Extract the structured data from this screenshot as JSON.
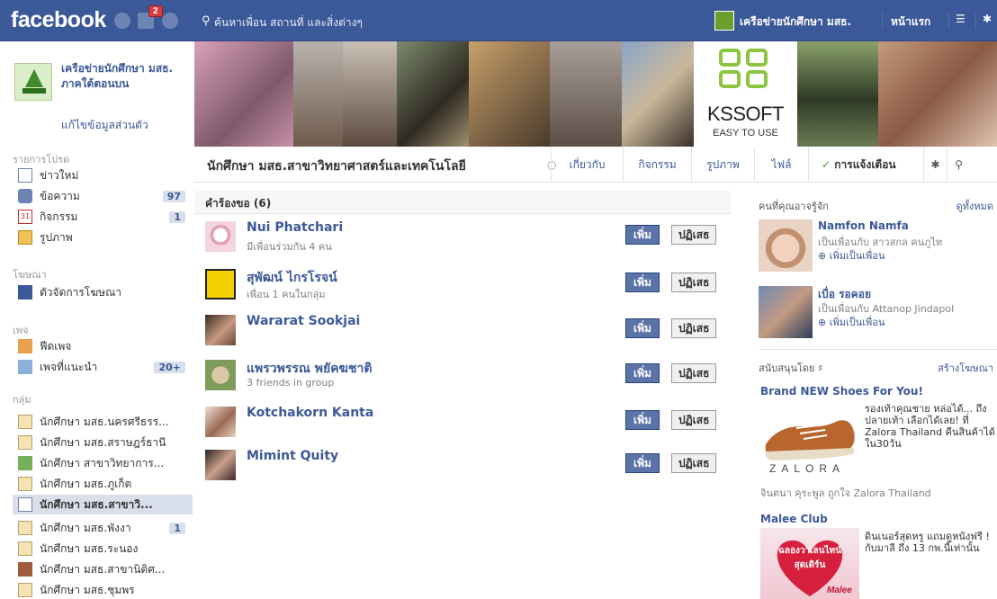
{
  "topbar": {
    "logo": "facebook",
    "notif_count": "2",
    "search_placeholder": "ค้นหาเพื่อน สถานที่ และสิ่งต่างๆ",
    "profile_name": "เครือข่ายนักศึกษา มสธ.",
    "home_label": "หน้าแรก"
  },
  "left": {
    "profile_name": "เครือข่ายนักศึกษา มสธ. ภาคใต้ตอนบน",
    "edit_profile": "แก้ไขข้อมูลส่วนตัว",
    "favorites_heading": "รายการโปรด",
    "favorites": [
      {
        "label": "ข่าวใหม่",
        "icon": "news-feed-icon",
        "count": ""
      },
      {
        "label": "ข้อความ",
        "icon": "messages-icon",
        "count": "97"
      },
      {
        "label": "กิจกรรม",
        "icon": "events-icon",
        "count": "1"
      },
      {
        "label": "รูปภาพ",
        "icon": "photos-icon",
        "count": ""
      }
    ],
    "ads_heading": "โฆษณา",
    "ads_item": "ตัวจัดการโฆษณา",
    "pages_heading": "เพจ",
    "pages": [
      {
        "label": "ฟีดเพจ",
        "count": ""
      },
      {
        "label": "เพจที่แนะนำ",
        "count": "20+"
      }
    ],
    "groups_heading": "กลุ่ม",
    "groups": [
      {
        "label": "นักศึกษา มสธ.นครศรีธรร...",
        "count": ""
      },
      {
        "label": "นักศึกษา มสธ.สราษฎร์ธานี",
        "count": ""
      },
      {
        "label": "นักศึกษา สาขาวิทยาการ...",
        "count": ""
      },
      {
        "label": "นักศึกษา มสธ.ภูเก็ต",
        "count": ""
      },
      {
        "label": "นักศึกษา มสธ.สาขาวิ...",
        "count": ""
      },
      {
        "label": "นักศึกษา มสธ.พังงา",
        "count": "1"
      },
      {
        "label": "นักศึกษา มสธ.ระนอง",
        "count": ""
      },
      {
        "label": "นักศึกษา มสธ.สาขานิติศ...",
        "count": ""
      },
      {
        "label": "นักศึกษา มสธ.ชุมพร",
        "count": ""
      }
    ]
  },
  "cover": {
    "brand": "KSSOFT",
    "tagline": "EASY TO USE"
  },
  "group": {
    "title": "นักศึกษา มสธ.สาขาวิทยาศาสตร์และเทคโนโลยี",
    "tabs": [
      "เกี่ยวกับ",
      "กิจกรรม",
      "รูปภาพ",
      "ไฟล์"
    ],
    "notifications": "การแจ้งเตือน"
  },
  "requests": {
    "heading": "คำร้องขอ (6)",
    "add_label": "เพิ่ม",
    "deny_label": "ปฏิเสธ",
    "items": [
      {
        "name": "Nui Phatchari",
        "sub": "มีเพื่อนร่วมกัน 4 คน"
      },
      {
        "name": "สุพัฒน์ ไกรโรจน์",
        "sub": "เพื่อน 1 คนในกลุ่ม"
      },
      {
        "name": "Wararat Sookjai",
        "sub": ""
      },
      {
        "name": "แพรวพรรณ พยัคฆชาติ",
        "sub": "3 friends in group"
      },
      {
        "name": "Kotchakorn Kanta",
        "sub": ""
      },
      {
        "name": "Mimint Quity",
        "sub": ""
      }
    ]
  },
  "right": {
    "pymk_heading": "คนที่คุณอาจรู้จัก",
    "see_all": "ดูทั้งหมด",
    "pymk": [
      {
        "name": "Namfon Namfa",
        "sub": "เป็นเพื่อนกับ สาวสกล คนภูไท",
        "add": "เพิ่มเป็นเพื่อน"
      },
      {
        "name": "เบื่อ รอคอย",
        "sub": "เป็นเพื่อนกับ Attanop Jindapol",
        "add": "เพิ่มเป็นเพื่อน"
      }
    ],
    "sponsored_heading": "สนับสนุนโดย",
    "create_ad": "สร้างโฆษณา",
    "ads": [
      {
        "title": "Brand NEW Shoes For You!",
        "text": "รองเท้าคุณชาย หล่อได้... ถึงปลายเท้า เลือกได้เลย! ที่ Zalora Thailand คืนสินค้าได้ใน30วัน",
        "brand": "ZALORA",
        "social": "จินตนา คุระพูล ถูกใจ Zalora Thailand"
      },
      {
        "title": "Malee Club",
        "text": "ดินเนอร์สุดหรู แถมดูหนังฟรี ! กับมาลี ถึง 13 กพ.นี้เท่านั้น",
        "promo": "ฉลองวาเลนไทน์ สุดเดิร์น",
        "brand": "Malee"
      }
    ]
  }
}
